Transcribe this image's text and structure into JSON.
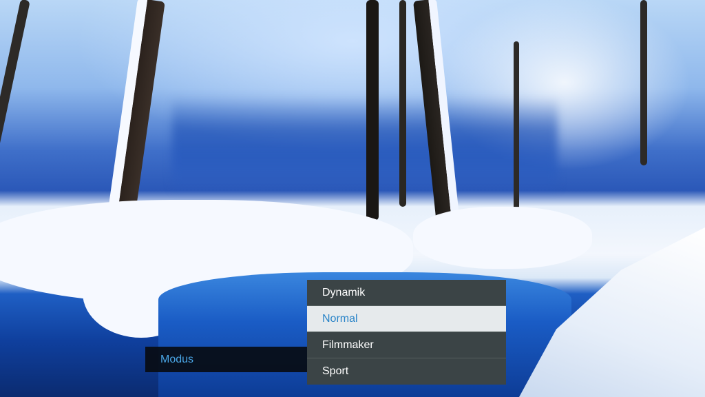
{
  "menu": {
    "label": "Modus",
    "options": [
      {
        "label": "Dynamik",
        "selected": false
      },
      {
        "label": "Normal",
        "selected": true
      },
      {
        "label": "Filmmaker",
        "selected": false
      },
      {
        "label": "Sport",
        "selected": false
      }
    ]
  },
  "colors": {
    "label_accent": "#4aa6e6",
    "selected_text": "#2a84c8",
    "selected_bg": "#e6eaec",
    "dropdown_bg": "#3b4446",
    "bar_bg": "#080c12"
  }
}
